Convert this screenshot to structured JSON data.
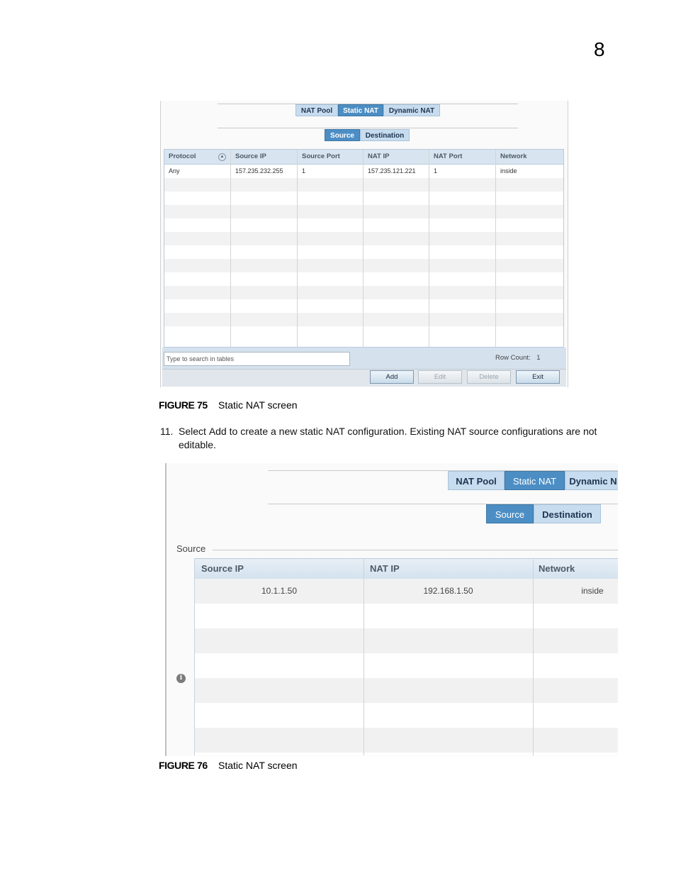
{
  "chapter_number": "8",
  "figure75": {
    "tabs": [
      "NAT Pool",
      "Static NAT",
      "Dynamic NAT"
    ],
    "subtabs": [
      "Source",
      "Destination"
    ],
    "columns": [
      "Protocol",
      "Source IP",
      "Source Port",
      "NAT IP",
      "NAT Port",
      "Network"
    ],
    "rows": [
      [
        "Any",
        "157.235.232.255",
        "1",
        "157.235.121.221",
        "1",
        "inside"
      ]
    ],
    "search_placeholder": "Type to search in tables",
    "row_count_label": "Row Count:",
    "row_count_value": "1",
    "buttons": {
      "add": "Add",
      "edit": "Edit",
      "delete": "Delete",
      "exit": "Exit"
    },
    "caption_label": "FIGURE 75",
    "caption_text": "Static NAT screen"
  },
  "step": {
    "number": "11.",
    "pre": "Select ",
    "keyword": "Add",
    "post": " to create a new static NAT configuration. Existing NAT source configurations are not editable."
  },
  "figure76": {
    "tabs": [
      "NAT Pool",
      "Static NAT",
      "Dynamic N"
    ],
    "subtabs": [
      "Source",
      "Destination"
    ],
    "section_label": "Source",
    "columns": [
      "Source IP",
      "NAT IP",
      "Network"
    ],
    "rows": [
      [
        "10.1.1.50",
        "192.168.1.50",
        "inside"
      ]
    ],
    "caption_label": "FIGURE 76",
    "caption_text": "Static NAT screen"
  }
}
